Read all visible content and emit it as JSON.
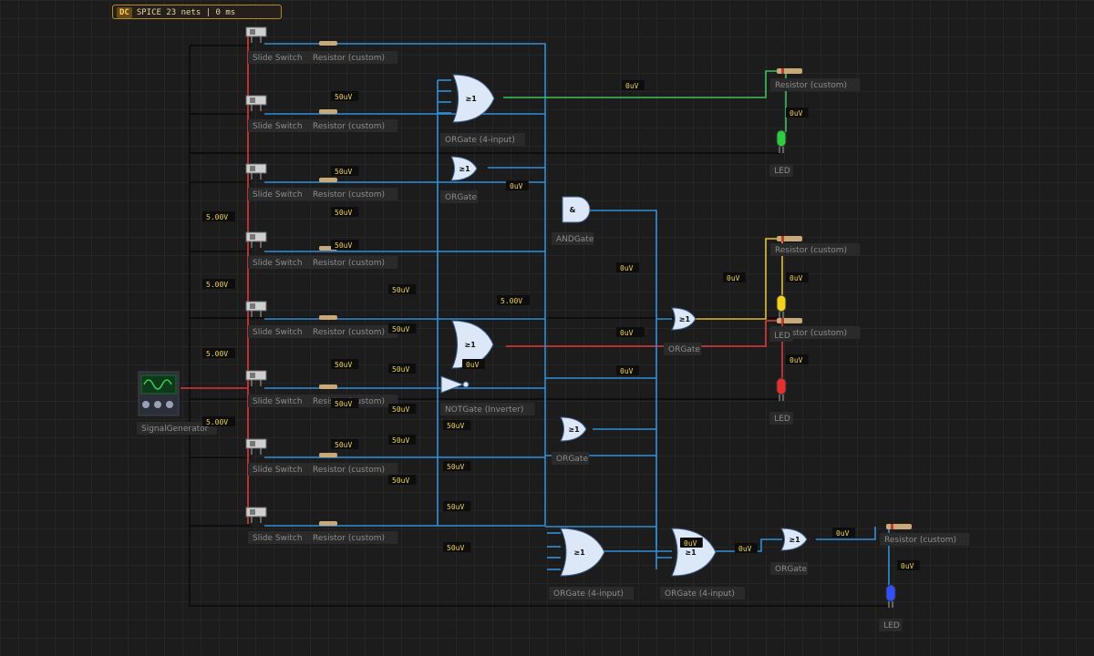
{
  "status": {
    "mode": "DC",
    "text": "SPICE 23 nets | 0 ms"
  },
  "labels": {
    "slide_switch": "Slide Switch",
    "resistor": "Resistor (custom)",
    "or_gate4": "ORGate (4-input)",
    "or_gate": "ORGate",
    "and_gate": "ANDGate",
    "not_gate": "NOTGate (Inverter)",
    "led": "LED",
    "signal_generator": "SignalGenerator"
  },
  "gate_symbols": {
    "or": "≥1",
    "and": "&"
  },
  "readouts": [
    "50uV",
    "50uV",
    "50uV",
    "50uV",
    "50uV",
    "50uV",
    "50uV",
    "50uV",
    "50uV",
    "50uV",
    "50uV",
    "50uV",
    "50uV",
    "50uV",
    "50uV",
    "50uV",
    "50uV",
    "5.00V",
    "5.00V",
    "5.00V",
    "5.00V",
    "5.00V",
    "0uV",
    "0uV",
    "0uV",
    "0uV",
    "0uV",
    "0uV",
    "0uV",
    "0uV",
    "0uV",
    "0uV",
    "0uV",
    "0uV",
    "0uV",
    "0uV",
    "0uV"
  ],
  "colors": {
    "wire_blue": "#2f8fd8",
    "wire_red": "#e03a3a",
    "wire_green": "#3cc25a",
    "wire_yellow": "#e3c12a",
    "wire_dark": "#0a0a0a",
    "led_green": "#2ecc40",
    "led_yellow": "#f2d21c",
    "led_red": "#e53030",
    "led_blue": "#3050ff"
  }
}
